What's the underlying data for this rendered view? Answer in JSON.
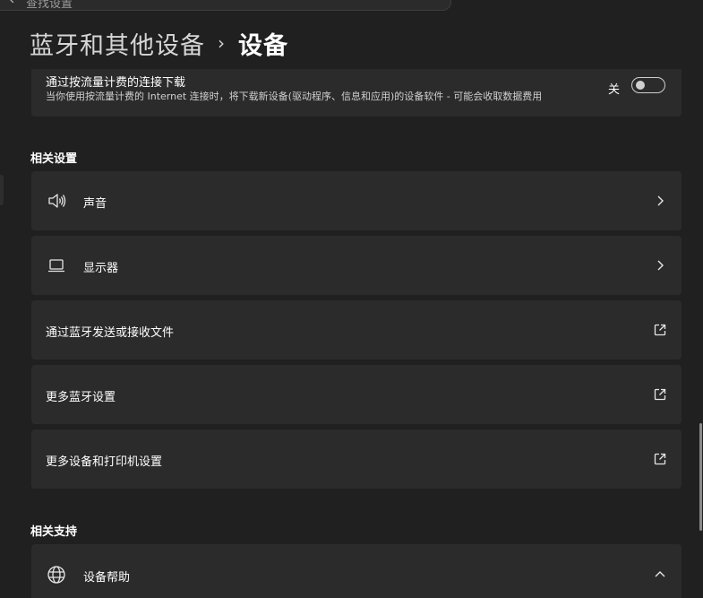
{
  "top_search": {
    "text": "查找设置"
  },
  "breadcrumb": {
    "parent": "蓝牙和其他设备",
    "separator": "›",
    "current": "设备"
  },
  "metered": {
    "title": "通过按流量计费的连接下载",
    "description": "当你使用按流量计费的 Internet 连接时，将下载新设备(驱动程序、信息和应用)的设备软件 - 可能会收取数据费用",
    "toggle_state_label": "关",
    "toggle_on": false
  },
  "related_settings": {
    "title": "相关设置",
    "items": [
      {
        "label": "声音",
        "icon": "speaker-icon",
        "trailing": "chevron-right"
      },
      {
        "label": "显示器",
        "icon": "laptop-icon",
        "trailing": "chevron-right"
      },
      {
        "label": "通过蓝牙发送或接收文件",
        "icon": "",
        "trailing": "external-link"
      },
      {
        "label": "更多蓝牙设置",
        "icon": "",
        "trailing": "external-link"
      },
      {
        "label": "更多设备和打印机设置",
        "icon": "",
        "trailing": "external-link"
      }
    ]
  },
  "related_support": {
    "title": "相关支持",
    "items": [
      {
        "label": "设备帮助",
        "icon": "globe-icon",
        "trailing": "chevron-up"
      }
    ]
  },
  "colors": {
    "background": "#202020",
    "card": "#2b2b2b",
    "text": "#ffffff"
  }
}
